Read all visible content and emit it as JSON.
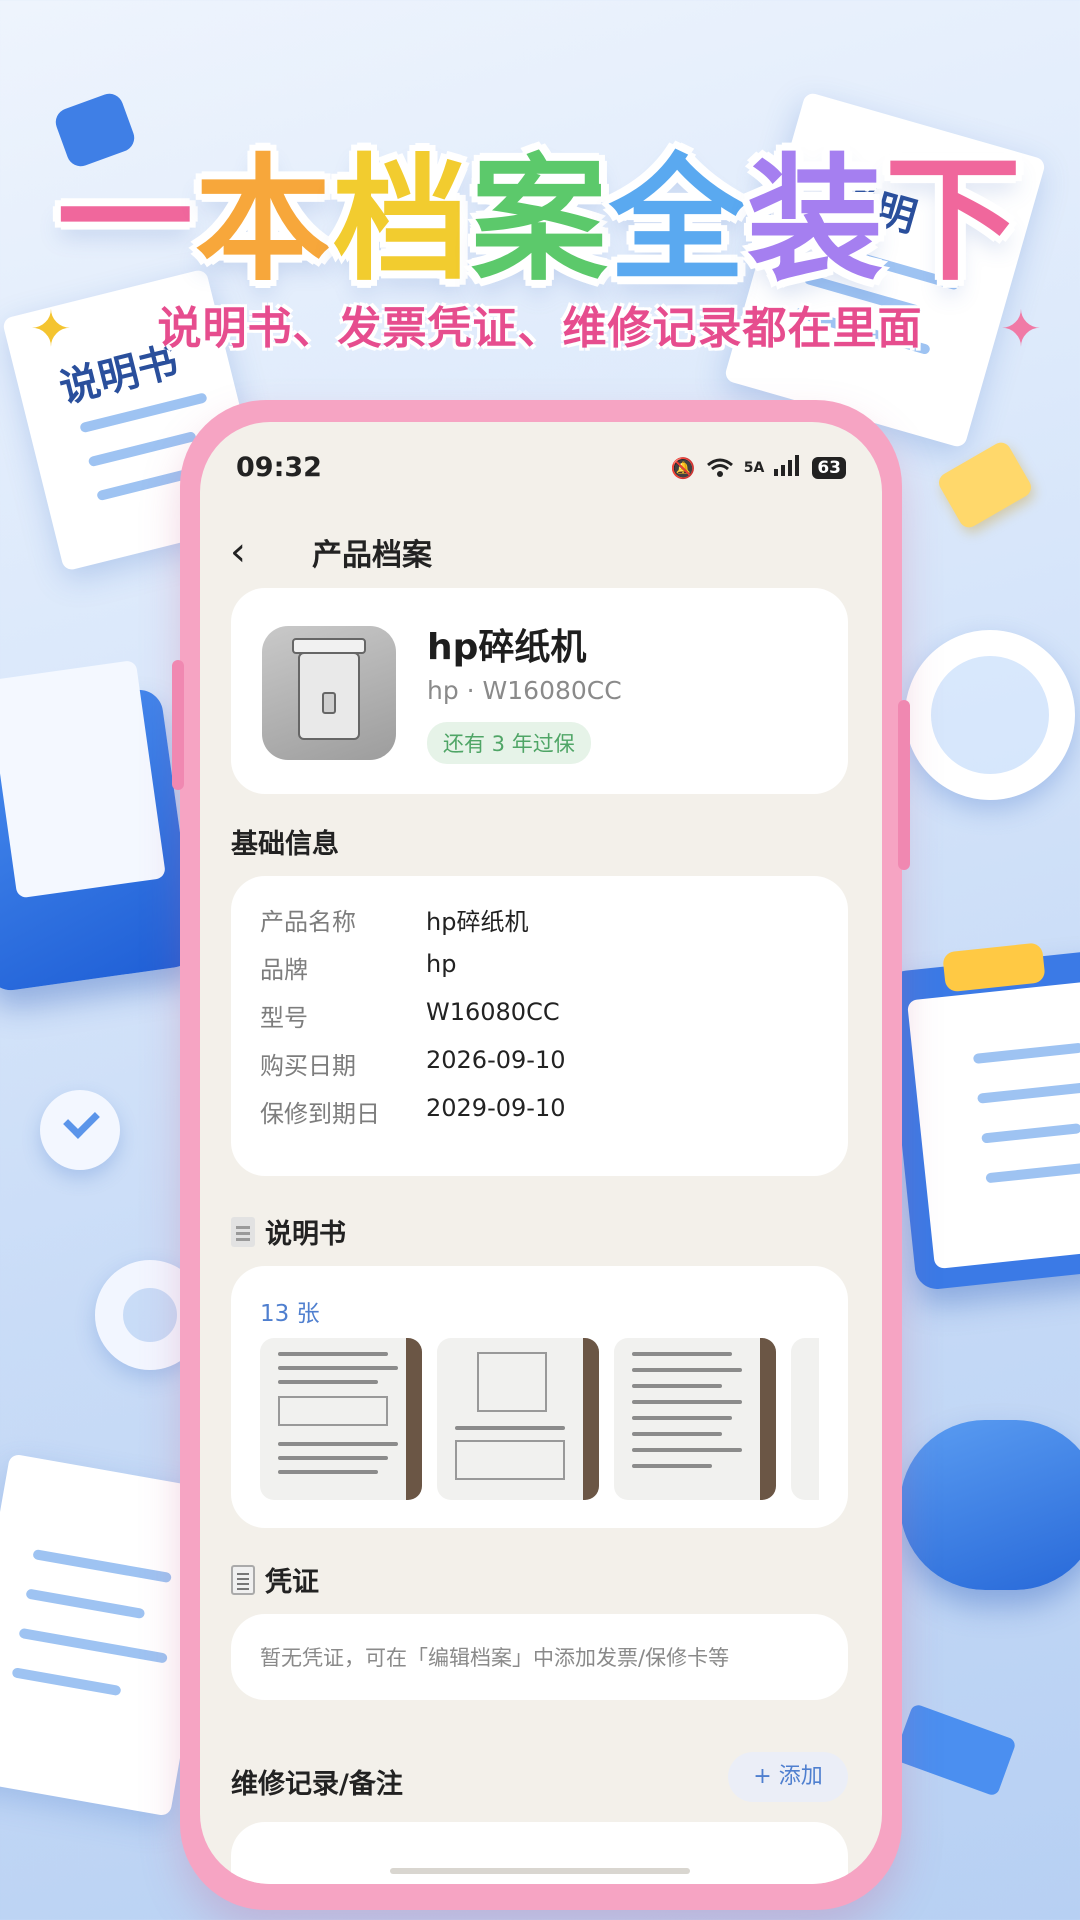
{
  "poster": {
    "title_chars": [
      {
        "char": "一",
        "color": "#f0679c"
      },
      {
        "char": "本",
        "color": "#f7a73b"
      },
      {
        "char": "档",
        "color": "#f2cc2f"
      },
      {
        "char": "案",
        "color": "#5cc96b"
      },
      {
        "char": "全",
        "color": "#5aa9f0"
      },
      {
        "char": "装",
        "color": "#a57ff0"
      },
      {
        "char": "下",
        "color": "#f0679c"
      }
    ],
    "subtitle": "说明书、发票凭证、维修记录都在里面",
    "deco_left_paper": "说明书",
    "deco_right_paper": "说明",
    "star_left": "✦",
    "star_right": "✦"
  },
  "status_bar": {
    "time": "09:32",
    "mute_icon": "🔕",
    "wifi_label": "6",
    "signal_label": "5A",
    "battery": "63"
  },
  "nav": {
    "back": "‹",
    "title": "产品档案"
  },
  "product": {
    "name": "hp碎纸机",
    "subtitle": "hp · W16080CC",
    "warranty_badge": "还有 3 年过保"
  },
  "basic_info": {
    "title": "基础信息",
    "rows": [
      {
        "label": "产品名称",
        "value": "hp碎纸机"
      },
      {
        "label": "品牌",
        "value": "hp"
      },
      {
        "label": "型号",
        "value": "W16080CC"
      },
      {
        "label": "购买日期",
        "value": "2026-09-10"
      },
      {
        "label": "保修到期日",
        "value": "2029-09-10"
      }
    ]
  },
  "manual": {
    "title": "说明书",
    "count": "13 张"
  },
  "voucher": {
    "title": "凭证",
    "empty_text": "暂无凭证，可在「编辑档案」中添加发票/保修卡等"
  },
  "repair": {
    "title": "维修记录/备注",
    "add_button": "+ 添加"
  },
  "colors": {
    "phone_frame": "#f6a4c3",
    "accent_blue": "#4f7fcf",
    "badge_green": "#4fa566"
  }
}
